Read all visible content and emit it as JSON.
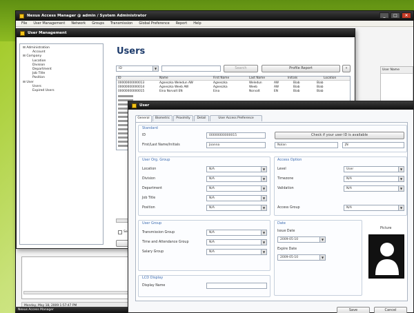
{
  "app": {
    "title": "Nexus Access Manager @ admin / System Administrator",
    "menu": [
      "File",
      "User Management",
      "Network",
      "Groups",
      "Transmission",
      "Global Preference",
      "Report",
      "Help"
    ],
    "status_text": "Monday, May 18, 2009  1:57:47 PM",
    "right_panel_header": "User Name",
    "bottom_window_title": "Nexus Access Manager"
  },
  "user_mgmt": {
    "title": "User Management",
    "heading": "Users",
    "search_field": "ID",
    "search_button": "Search",
    "profile_button": "Profile Report",
    "tree": [
      "Administration",
      "Account",
      "Company",
      "Location",
      "Division",
      "Department",
      "Job Title",
      "Position",
      "User",
      "Users",
      "Expired Users"
    ],
    "columns": [
      "ID",
      "Name",
      "First Name",
      "Last Name",
      "Initials",
      "Location"
    ],
    "rows": [
      [
        "00000000000013",
        "Agneszka Weledun AW",
        "Agneszka",
        "Weledun",
        "AW",
        "Biab",
        "Biab"
      ],
      [
        "00000000000014",
        "Agneszka Weeb AW",
        "Agneszka",
        "Weeb",
        "AW",
        "Biab",
        "Biab"
      ],
      [
        "00000000000015",
        "Eina Norvalt EN",
        "Eina",
        "Norvalt",
        "EN",
        "Biab",
        "Biab"
      ]
    ],
    "select_label": "Sele"
  },
  "user_dialog": {
    "title": "User",
    "tabs": [
      "General",
      "Biometric",
      "Proximity",
      "Detail",
      "User Access Preference"
    ],
    "standard": {
      "label": "Standard",
      "id_label": "ID",
      "id_value": "00000000000015",
      "name_label": "First/Last Name/Initials",
      "first": "Joanna",
      "last": "Nolan",
      "initials": "JN",
      "check_button": "Check if your user ID is available"
    },
    "org": {
      "label": "User Org. Group",
      "fields": [
        {
          "label": "Location",
          "value": "N/A"
        },
        {
          "label": "Division",
          "value": "N/A"
        },
        {
          "label": "Department",
          "value": "N/A"
        },
        {
          "label": "Job Title",
          "value": "N/A"
        },
        {
          "label": "Position",
          "value": "N/A"
        }
      ]
    },
    "access": {
      "label": "Access Option",
      "fields": [
        {
          "label": "Level",
          "value": "User"
        },
        {
          "label": "Timezone",
          "value": "N/A"
        },
        {
          "label": "Validation",
          "value": "N/A"
        },
        {
          "label": "Access Group",
          "value": "N/A"
        }
      ]
    },
    "user_group": {
      "label": "User Group",
      "fields": [
        {
          "label": "Transmission Group",
          "value": "N/A"
        },
        {
          "label": "Time and Attendance Group",
          "value": "N/A"
        },
        {
          "label": "Salary Group",
          "value": "N/A"
        }
      ]
    },
    "date": {
      "label": "Date",
      "issue_label": "Issue Date",
      "issue_value": "2009-05-10",
      "expire_label": "Expire Date",
      "expire_value": "2009-05-10"
    },
    "lcd": {
      "label": "LCD Display",
      "display_label": "Display Name",
      "display_value": ""
    },
    "picture_label": "Picture",
    "save": "Save",
    "cancel": "Cancel"
  },
  "colors": {
    "accent": "#3b6bb0",
    "titlebar": "#1a1a1a",
    "background": "#9ec81f"
  }
}
